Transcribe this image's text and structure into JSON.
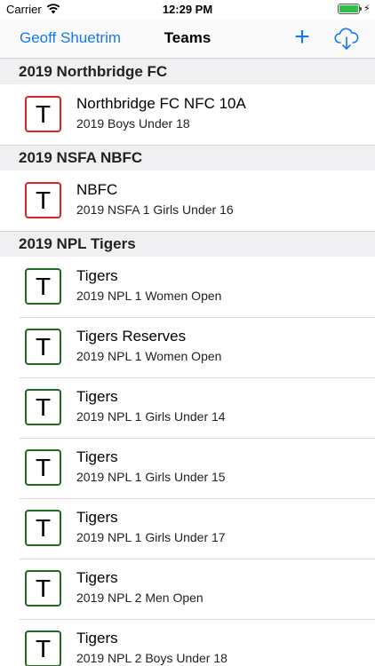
{
  "status_bar": {
    "carrier": "Carrier",
    "time": "12:29 PM",
    "battery_level": 1.0,
    "charging_symbol": "⚡"
  },
  "nav": {
    "back_label": "Geoff Shuetrim",
    "title": "Teams",
    "add_symbol": "+",
    "cloud_icon": "cloud-download-icon"
  },
  "colors": {
    "accent": "#1478f5",
    "red_team": "#d8232a",
    "green_team": "#1e6b1e"
  },
  "sections": [
    {
      "header": "2019 Northbridge FC",
      "rows": [
        {
          "letter": "T",
          "color": "#d8232a",
          "title": "Northbridge FC NFC 10A",
          "subtitle": "2019 Boys Under 18"
        }
      ]
    },
    {
      "header": "2019 NSFA NBFC",
      "rows": [
        {
          "letter": "T",
          "color": "#d8232a",
          "title": "NBFC",
          "subtitle": "2019 NSFA 1 Girls Under 16"
        }
      ]
    },
    {
      "header": "2019 NPL Tigers",
      "rows": [
        {
          "letter": "T",
          "color": "#1e6b1e",
          "title": "Tigers",
          "subtitle": "2019 NPL 1 Women Open"
        },
        {
          "letter": "T",
          "color": "#1e6b1e",
          "title": "Tigers Reserves",
          "subtitle": "2019 NPL 1 Women Open"
        },
        {
          "letter": "T",
          "color": "#1e6b1e",
          "title": "Tigers",
          "subtitle": "2019 NPL 1 Girls Under 14"
        },
        {
          "letter": "T",
          "color": "#1e6b1e",
          "title": "Tigers",
          "subtitle": "2019 NPL 1 Girls Under 15"
        },
        {
          "letter": "T",
          "color": "#1e6b1e",
          "title": "Tigers",
          "subtitle": "2019 NPL 1 Girls Under 17"
        },
        {
          "letter": "T",
          "color": "#1e6b1e",
          "title": "Tigers",
          "subtitle": "2019 NPL 2 Men Open"
        },
        {
          "letter": "T",
          "color": "#1e6b1e",
          "title": "Tigers",
          "subtitle": "2019 NPL 2 Boys Under 18"
        }
      ]
    }
  ]
}
